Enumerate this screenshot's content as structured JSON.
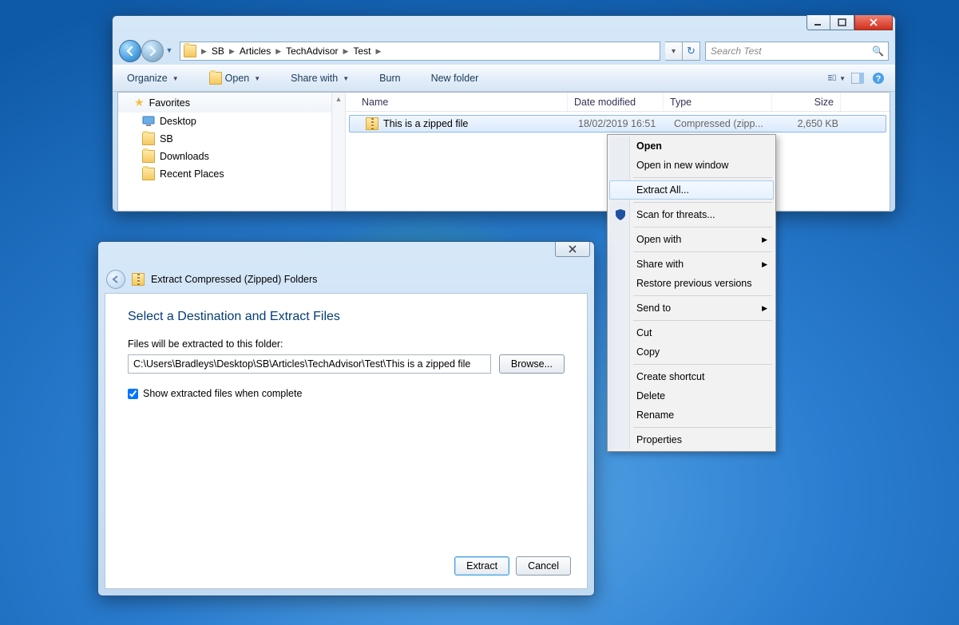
{
  "explorer": {
    "breadcrumbs": [
      "SB",
      "Articles",
      "TechAdvisor",
      "Test"
    ],
    "search_placeholder": "Search Test",
    "toolbar": {
      "organize": "Organize",
      "open": "Open",
      "share": "Share with",
      "burn": "Burn",
      "newfolder": "New folder"
    },
    "nav": {
      "favorites": "Favorites",
      "items": [
        "Desktop",
        "SB",
        "Downloads",
        "Recent Places"
      ]
    },
    "columns": {
      "name": "Name",
      "date": "Date modified",
      "type": "Type",
      "size": "Size"
    },
    "file": {
      "name": "This is a zipped file",
      "date": "18/02/2019 16:51",
      "type": "Compressed (zipp...",
      "size": "2,650 KB"
    }
  },
  "context_menu": {
    "open": "Open",
    "open_new": "Open in new window",
    "extract": "Extract All...",
    "scan": "Scan for threats...",
    "open_with": "Open with",
    "share_with": "Share with",
    "restore": "Restore previous versions",
    "send_to": "Send to",
    "cut": "Cut",
    "copy": "Copy",
    "shortcut": "Create shortcut",
    "delete": "Delete",
    "rename": "Rename",
    "properties": "Properties"
  },
  "dialog": {
    "header": "Extract Compressed (Zipped) Folders",
    "title": "Select a Destination and Extract Files",
    "label": "Files will be extracted to this folder:",
    "path": "C:\\Users\\Bradleys\\Desktop\\SB\\Articles\\TechAdvisor\\Test\\This is a zipped file",
    "browse": "Browse...",
    "checkbox": "Show extracted files when complete",
    "extract": "Extract",
    "cancel": "Cancel"
  }
}
